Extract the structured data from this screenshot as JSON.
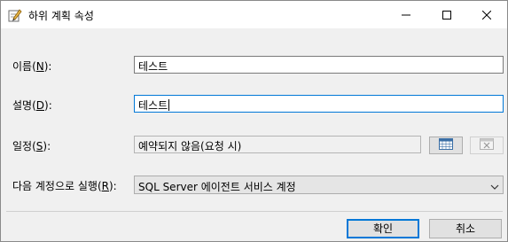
{
  "window": {
    "title": "하위 계획 속성",
    "icon": "edit-properties-icon",
    "controls": [
      "minimize-icon",
      "maximize-icon",
      "close-icon"
    ]
  },
  "form": {
    "name": {
      "label_text": "이름(",
      "label_key": "N",
      "label_tail": "):",
      "value": "테스트"
    },
    "description": {
      "label_text": "설명(",
      "label_key": "D",
      "label_tail": "):",
      "value": "테스트"
    },
    "schedule": {
      "label_text": "일정(",
      "label_key": "S",
      "label_tail": "):",
      "value": "예약되지 않음(요청 시)"
    },
    "run_as": {
      "label_text": "다음 계정으로 실행(",
      "label_key": "R",
      "label_tail": "):",
      "value": "SQL Server 에이전트 서비스 계정"
    }
  },
  "buttons": {
    "ok": "확인",
    "cancel": "취소"
  },
  "colors": {
    "focus_border": "#0078d7",
    "dialog_bg": "#f0f0f0"
  }
}
